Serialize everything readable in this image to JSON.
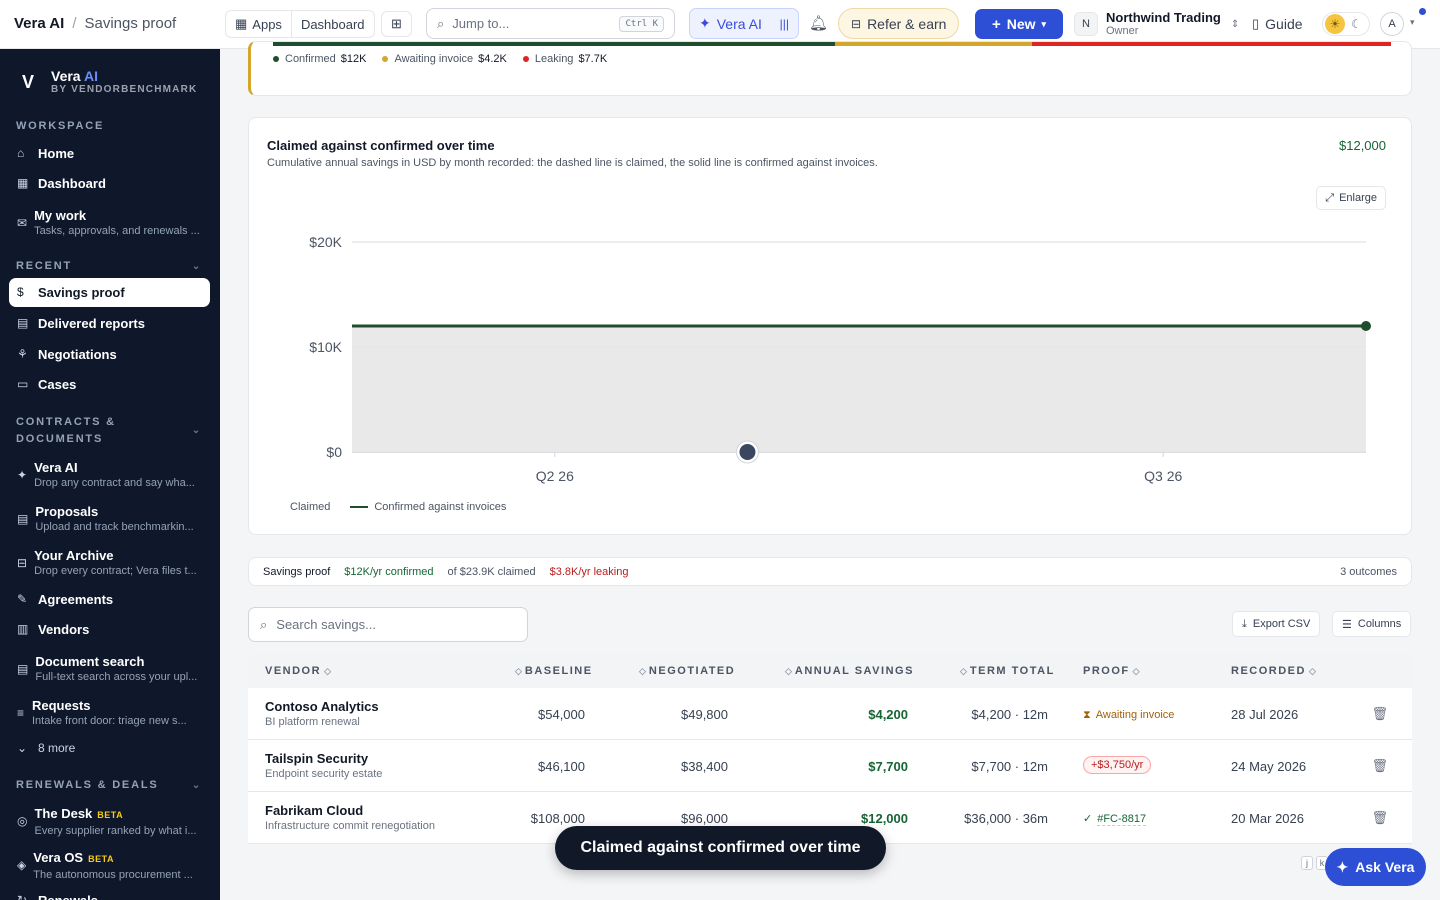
{
  "topbar": {
    "brand": "Vera AI",
    "breadcrumb": "Savings proof",
    "apps_label": "Apps",
    "dashboard_label": "Dashboard",
    "search_placeholder": "Jump to...",
    "search_shortcut": "Ctrl K",
    "vera_label": "Vera AI",
    "refer_label": "Refer & earn",
    "new_label": "New",
    "org_initial": "N",
    "org_name": "Northwind Trading",
    "org_role": "Owner",
    "guide_label": "Guide",
    "avatar_initial": "A"
  },
  "sidebar": {
    "logo_name": "Vera",
    "logo_ai": "AI",
    "logo_by": "BY VENDORBENCHMARK",
    "sections": {
      "workspace": "WORKSPACE",
      "recent": "RECENT",
      "contracts": "CONTRACTS & DOCUMENTS",
      "renewals": "RENEWALS & DEALS"
    },
    "items": {
      "home": {
        "label": "Home"
      },
      "dashboard": {
        "label": "Dashboard"
      },
      "mywork": {
        "label": "My work",
        "sub": "Tasks, approvals, and renewals ..."
      },
      "savings": {
        "label": "Savings proof"
      },
      "delivered": {
        "label": "Delivered reports"
      },
      "negotiations": {
        "label": "Negotiations"
      },
      "cases": {
        "label": "Cases"
      },
      "veraai": {
        "label": "Vera AI",
        "sub": "Drop any contract and say wha..."
      },
      "proposals": {
        "label": "Proposals",
        "sub": "Upload and track benchmarkin..."
      },
      "archive": {
        "label": "Your Archive",
        "sub": "Drop every contract; Vera files t..."
      },
      "agreements": {
        "label": "Agreements"
      },
      "vendors": {
        "label": "Vendors"
      },
      "docsearch": {
        "label": "Document search",
        "sub": "Full-text search across your upl..."
      },
      "requests": {
        "label": "Requests",
        "sub": "Intake front door: triage new s..."
      },
      "more": {
        "label": "8 more"
      },
      "desk": {
        "label": "The Desk",
        "badge": "BETA",
        "sub": "Every supplier ranked by what i..."
      },
      "veraos": {
        "label": "Vera OS",
        "badge": "BETA",
        "sub": "The autonomous procurement ..."
      },
      "renewals": {
        "label": "Renewals"
      }
    }
  },
  "status_bar": {
    "confirmed_label": "Confirmed",
    "confirmed_value": "$12K",
    "awaiting_label": "Awaiting invoice",
    "awaiting_value": "$4.2K",
    "leaking_label": "Leaking",
    "leaking_value": "$7.7K",
    "colors": {
      "confirmed": "#1f4d2e",
      "awaiting": "#d4a72c",
      "leaking": "#dc2626"
    }
  },
  "chart_card": {
    "title": "Claimed against confirmed over time",
    "subtitle": "Cumulative annual savings in USD by month recorded: the dashed line is claimed, the solid line is confirmed against invoices.",
    "headline_value": "$12,000",
    "enlarge_label": "Enlarge",
    "legend_claimed": "Claimed",
    "legend_confirmed": "Confirmed against invoices"
  },
  "chart_data": {
    "type": "line",
    "x_ticks": [
      "Q2 26",
      "Q3 26"
    ],
    "y_ticks": [
      "$0",
      "$10K",
      "$20K"
    ],
    "ylim": [
      0,
      20000
    ],
    "x_domain": [
      0,
      1
    ],
    "series": [
      {
        "name": "Confirmed against invoices",
        "style": "solid",
        "color": "#1f4d2e",
        "x": [
          0,
          1
        ],
        "values": [
          12000,
          12000
        ]
      }
    ],
    "hover_x": 0.39,
    "hover_value": 0,
    "grid": true
  },
  "summary": {
    "label": "Savings proof",
    "confirmed": "$12K/yr confirmed",
    "claimed": "of $23.9K claimed",
    "leaking": "$3.8K/yr leaking",
    "count": "3 outcomes"
  },
  "table_controls": {
    "search_placeholder": "Search savings...",
    "export_label": "Export CSV",
    "columns_label": "Columns"
  },
  "table": {
    "headers": {
      "vendor": "VENDOR",
      "baseline": "BASELINE",
      "negotiated": "NEGOTIATED",
      "savings": "ANNUAL SAVINGS",
      "term": "TERM TOTAL",
      "proof": "PROOF",
      "recorded": "RECORDED"
    },
    "rows": [
      {
        "vendor": "Contoso Analytics",
        "sub": "BI platform renewal",
        "baseline": "$54,000",
        "negotiated": "$49,800",
        "savings": "$4,200",
        "term": "$4,200 · 12m",
        "proof": "Awaiting invoice",
        "recorded": "28 Jul 2026"
      },
      {
        "vendor": "Tailspin Security",
        "sub": "Endpoint security estate",
        "baseline": "$46,100",
        "negotiated": "$38,400",
        "savings": "$7,700",
        "term": "$7,700 · 12m",
        "proof": "+$3,750/yr",
        "recorded": "24 May 2026"
      },
      {
        "vendor": "Fabrikam Cloud",
        "sub": "Infrastructure commit renegotiation",
        "baseline": "$108,000",
        "negotiated": "$96,000",
        "savings": "$12,000",
        "term": "$36,000 · 36m",
        "proof": "#FC-8817",
        "recorded": "20 Mar 2026"
      }
    ]
  },
  "toast": "Claimed against confirmed over time",
  "ask_label": "Ask Vera",
  "kbd": {
    "j": "j",
    "k": "k"
  }
}
